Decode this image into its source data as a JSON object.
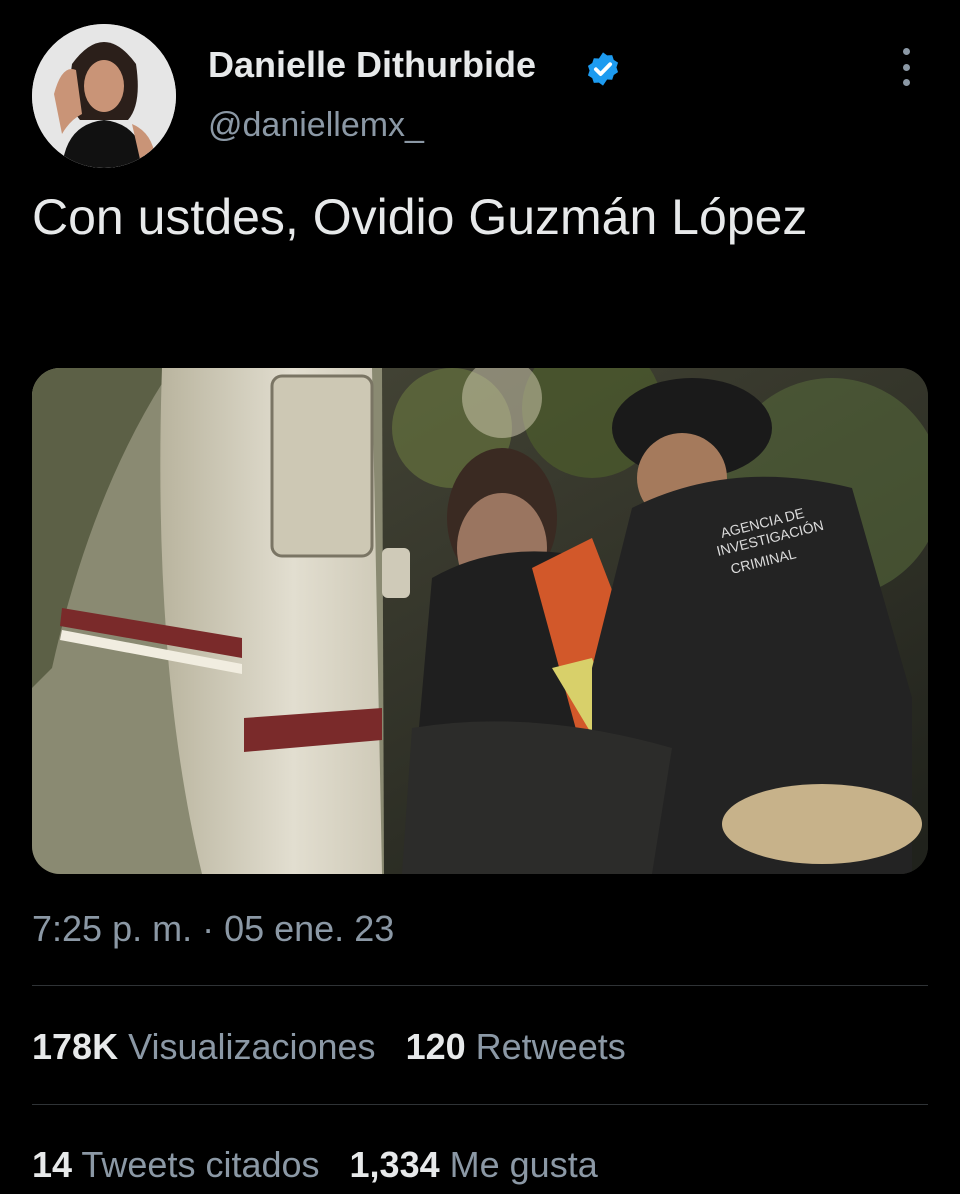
{
  "user": {
    "display_name": "Danielle Dithurbide",
    "handle": "@daniellemx_",
    "verified": true,
    "verified_color": "#1d9bf0"
  },
  "tweet": {
    "text": "Con ustdes, Ovidio Guzmán López",
    "timestamp": "7:25 p. m. · 05 ene. 23"
  },
  "stats_row1": [
    {
      "count": "178K",
      "label": "Visualizaciones"
    },
    {
      "count": "120",
      "label": "Retweets"
    }
  ],
  "stats_row2": [
    {
      "count": "14",
      "label": "Tweets citados"
    },
    {
      "count": "1,334",
      "label": "Me gusta"
    }
  ],
  "icons": {
    "more": "more-vertical-icon",
    "verified": "verified-badge-icon"
  }
}
